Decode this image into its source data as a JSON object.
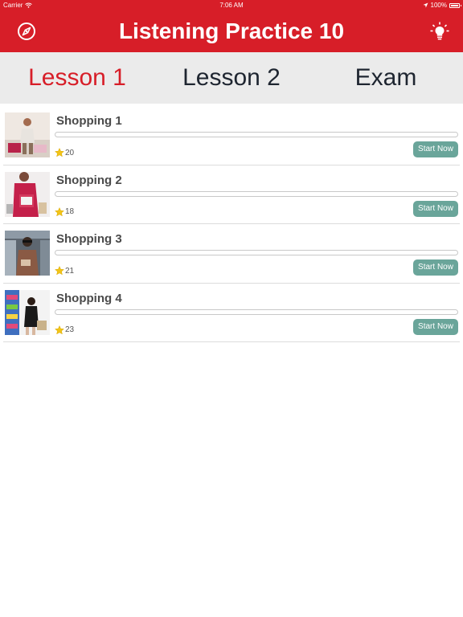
{
  "status_bar": {
    "carrier": "Carrier",
    "time": "7:06 AM",
    "battery": "100%"
  },
  "nav": {
    "title": "Listening Practice 10",
    "left_icon": "compass-icon",
    "right_icon": "lightbulb-icon"
  },
  "tabs": [
    {
      "label": "Lesson 1",
      "active": true
    },
    {
      "label": "Lesson 2",
      "active": false
    },
    {
      "label": "Exam",
      "active": false
    }
  ],
  "lessons": [
    {
      "title": "Shopping 1",
      "stars": "20",
      "button": "Start Now",
      "progress": 0
    },
    {
      "title": "Shopping 2",
      "stars": "18",
      "button": "Start Now",
      "progress": 0
    },
    {
      "title": "Shopping 3",
      "stars": "21",
      "button": "Start Now",
      "progress": 0
    },
    {
      "title": "Shopping 4",
      "stars": "23",
      "button": "Start Now",
      "progress": 0
    }
  ],
  "colors": {
    "brand": "#d71e28",
    "accent": "#6aa59a",
    "tab_bg": "#ebebeb"
  }
}
